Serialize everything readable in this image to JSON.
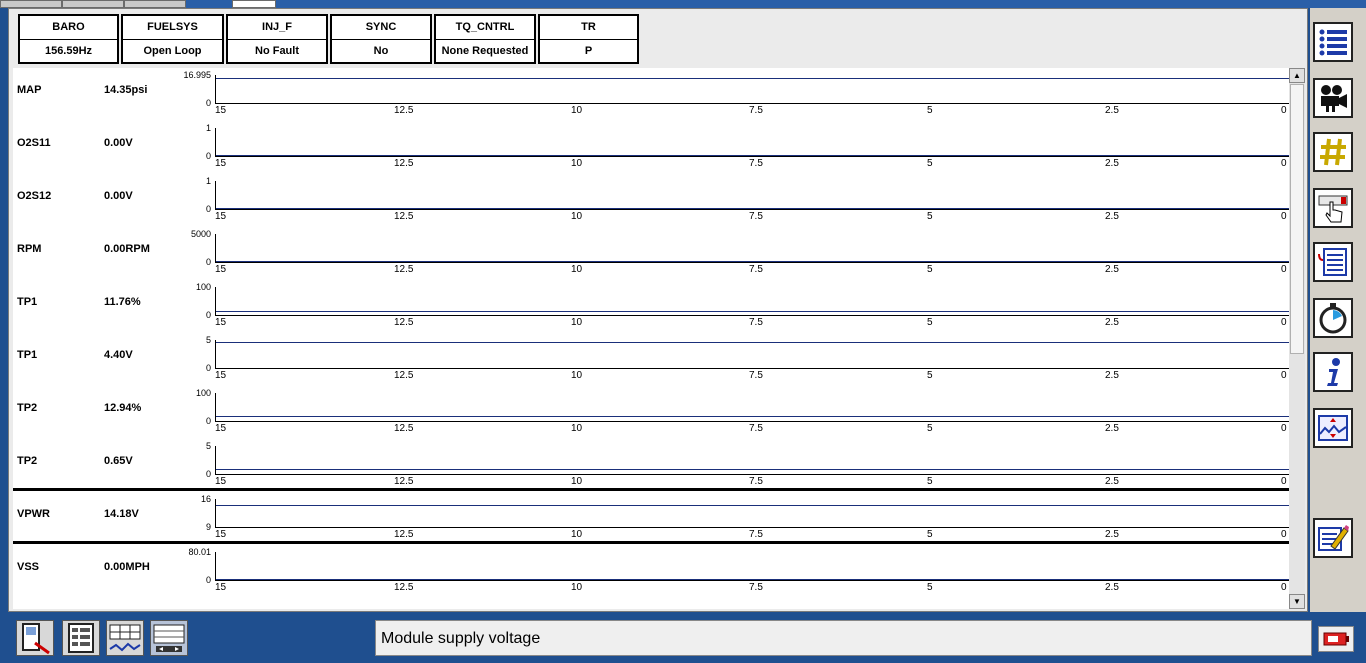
{
  "pid_boxes": [
    {
      "title": "BARO",
      "value": "156.59Hz"
    },
    {
      "title": "FUELSYS",
      "value": "Open Loop"
    },
    {
      "title": "INJ_F",
      "value": "No Fault"
    },
    {
      "title": "SYNC",
      "value": "No"
    },
    {
      "title": "TQ_CNTRL",
      "value": "None Requested"
    },
    {
      "title": "TR",
      "value": "P"
    }
  ],
  "x_ticks": [
    "15",
    "12.5",
    "10",
    "7.5",
    "5",
    "2.5",
    "0"
  ],
  "graphs": [
    {
      "name": "MAP",
      "value": "14.35psi",
      "ymax": "16.995",
      "ymin": "0",
      "level": 0.844
    },
    {
      "name": "O2S11",
      "value": "0.00V",
      "ymax": "1",
      "ymin": "0",
      "level": 0.0
    },
    {
      "name": "O2S12",
      "value": "0.00V",
      "ymax": "1",
      "ymin": "0",
      "level": 0.0
    },
    {
      "name": "RPM",
      "value": "0.00RPM",
      "ymax": "5000",
      "ymin": "0",
      "level": 0.0
    },
    {
      "name": "TP1",
      "value": "11.76%",
      "ymax": "100",
      "ymin": "0",
      "level": 0.1176
    },
    {
      "name": "TP1",
      "value": "4.40V",
      "ymax": "5",
      "ymin": "0",
      "level": 0.88
    },
    {
      "name": "TP2",
      "value": "12.94%",
      "ymax": "100",
      "ymin": "0",
      "level": 0.1294
    },
    {
      "name": "TP2",
      "value": "0.65V",
      "ymax": "5",
      "ymin": "0",
      "level": 0.13
    },
    {
      "name": "VPWR",
      "value": "14.18V",
      "ymax": "16",
      "ymin": "9",
      "level": 0.74
    },
    {
      "name": "VSS",
      "value": "0.00MPH",
      "ymax": "80.01",
      "ymin": "0",
      "level": 0.0
    }
  ],
  "sidebar_icons": [
    "list-icon",
    "movie-camera-icon",
    "hash-icon",
    "pointer-hand-icon",
    "document-icon",
    "stopwatch-icon",
    "info-icon",
    "graph-zoom-icon",
    "clear-edit-icon"
  ],
  "bottom_icons": [
    "scan-tool-icon",
    "module-list-icon",
    "pid-table-icon",
    "graph-view-icon"
  ],
  "status": {
    "text": "Module supply voltage"
  },
  "colors": {
    "trace": "#1a2f7a",
    "frame": "#1f4f8f",
    "panel": "#ebebeb"
  }
}
